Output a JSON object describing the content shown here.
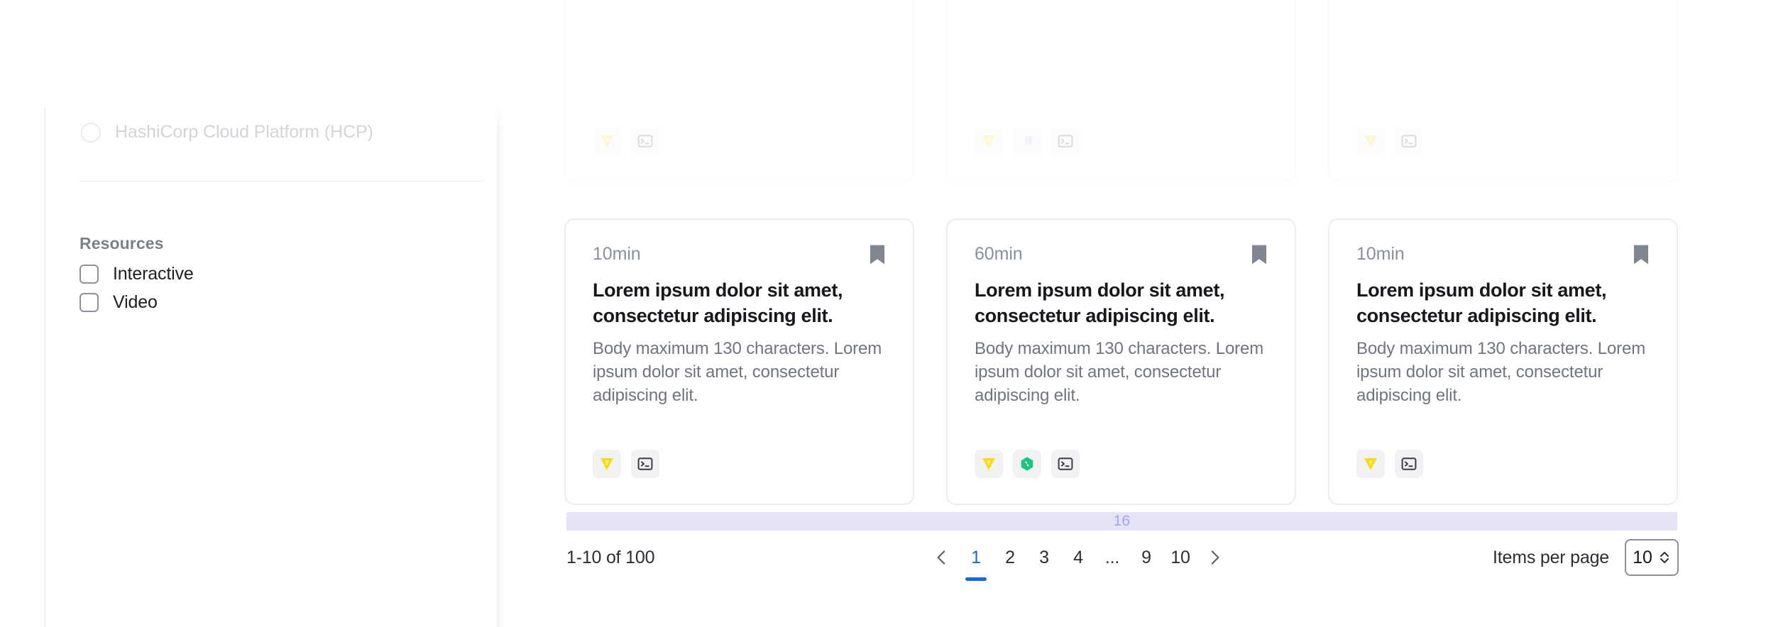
{
  "sidebar": {
    "faded_filter": {
      "label": "HashiCorp Cloud Platform (HCP)",
      "control": "radio",
      "checked": false
    },
    "groups": [
      {
        "title": "Resources",
        "options": [
          {
            "label": "Interactive",
            "checked": false
          },
          {
            "label": "Video",
            "checked": false
          }
        ]
      }
    ]
  },
  "results": {
    "clipped_row": [
      {
        "badges": [
          "vault-icon",
          "terminal-icon"
        ]
      },
      {
        "badges": [
          "vault-icon",
          "terraform-icon",
          "terminal-icon"
        ]
      },
      {
        "badges": [
          "vault-icon",
          "terminal-icon"
        ]
      }
    ],
    "cards": [
      {
        "duration": "10min",
        "title": "Lorem ipsum dolor sit amet, consectetur adipiscing elit.",
        "body": "Body maximum 130 characters. Lorem ipsum dolor sit amet, consectetur adipiscing elit.",
        "bookmark": "bookmark-icon",
        "badges": [
          "vault-icon",
          "terminal-icon"
        ]
      },
      {
        "duration": "60min",
        "title": "Lorem ipsum dolor sit amet, consectetur adipiscing elit.",
        "body": "Body maximum 130 characters. Lorem ipsum dolor sit amet, consectetur adipiscing elit.",
        "bookmark": "bookmark-icon",
        "badges": [
          "vault-icon",
          "nomad-icon",
          "terminal-icon"
        ]
      },
      {
        "duration": "10min",
        "title": "Lorem ipsum dolor sit amet, consectetur adipiscing elit.",
        "body": "Body maximum 130 characters. Lorem ipsum dolor sit amet, consectetur adipiscing elit.",
        "bookmark": "bookmark-icon",
        "badges": [
          "vault-icon",
          "terminal-icon"
        ]
      }
    ]
  },
  "hint_band": {
    "label": "16"
  },
  "pagination": {
    "summary": "1-10 of 100",
    "prev_icon": "chevron-left-icon",
    "next_icon": "chevron-right-icon",
    "pages": [
      "1",
      "2",
      "3",
      "4",
      "...",
      "9",
      "10"
    ],
    "active_page": "1",
    "items_per_page_label": "Items per page",
    "items_per_page_value": "10",
    "stepper_icon": "chevron-up-down-icon"
  },
  "colors": {
    "accent_blue": "#1767e8",
    "vault_yellow": "#ffd814",
    "terraform_purple": "#c7b5f5",
    "nomad_green": "#18c77c",
    "band_lavender": "#e5e3f6",
    "band_text": "#a6a1ee",
    "card_border": "#ebedf0",
    "muted_text": "#6f747e"
  }
}
